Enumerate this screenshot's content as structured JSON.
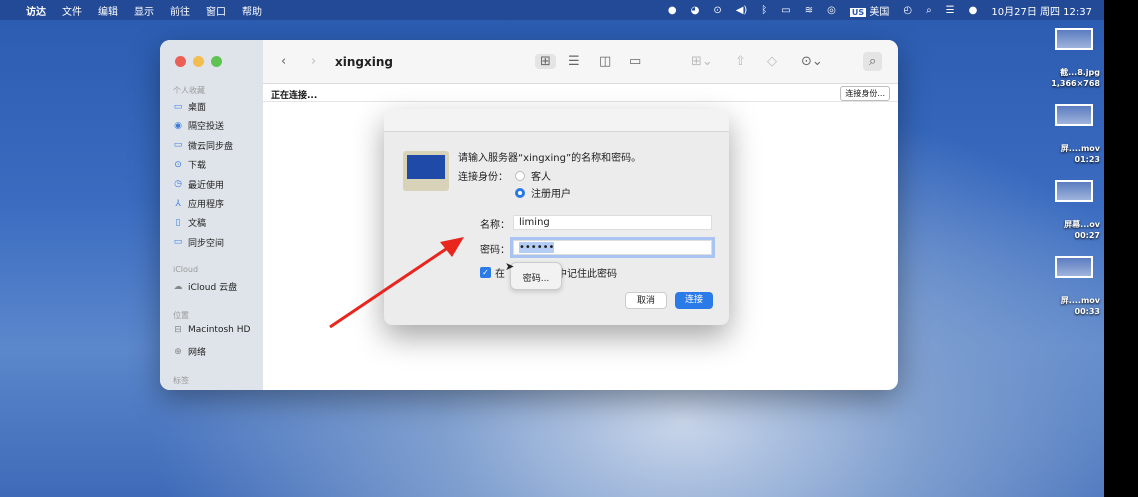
{
  "menubar": {
    "apple": "",
    "items": [
      "访达",
      "文件",
      "编辑",
      "显示",
      "前往",
      "窗口",
      "帮助"
    ],
    "input_source": "美国",
    "datetime": "10月27日 周四 12:37"
  },
  "finder": {
    "title": "xingxing",
    "status": "正在连接...",
    "connect_as": "连接身份...",
    "sidebar": {
      "favorites": "个人收藏",
      "items": [
        {
          "icon": "desktop-icon",
          "g": "▭",
          "label": "桌面"
        },
        {
          "icon": "airdrop-icon",
          "g": "◉",
          "label": "隔空投送"
        },
        {
          "icon": "folder-icon",
          "g": "▭",
          "label": "微云同步盘"
        },
        {
          "icon": "download-icon",
          "g": "⊙",
          "label": "下载"
        },
        {
          "icon": "recent-icon",
          "g": "◷",
          "label": "最近使用"
        },
        {
          "icon": "apps-icon",
          "g": "⅄",
          "label": "应用程序"
        },
        {
          "icon": "document-icon",
          "g": "▯",
          "label": "文稿"
        },
        {
          "icon": "folder-icon",
          "g": "▭",
          "label": "同步空间"
        }
      ],
      "icloud": "iCloud",
      "icloud_drive": "iCloud 云盘",
      "locations": "位置",
      "mac_hd": "Macintosh HD",
      "network": "网络",
      "tags": "标签"
    }
  },
  "dialog": {
    "prompt": "请输入服务器“xingxing”的名称和密码。",
    "connect_as_label": "连接身份：",
    "guest": "客人",
    "registered": "注册用户",
    "name_label": "名称：",
    "name_value": "liming",
    "password_label": "密码：",
    "password_value": "••••••",
    "remember_prefix": "在",
    "remember_suffix": "中记住此密码",
    "tooltip": "密码...",
    "cancel": "取消",
    "connect": "连接"
  },
  "desktop": [
    {
      "name": "截...8.jpg",
      "meta": "1,366×768"
    },
    {
      "name": "屏....mov",
      "meta": "01:23"
    },
    {
      "name": "屏幕...ov",
      "meta": "00:27"
    },
    {
      "name": "屏....mov",
      "meta": "00:33"
    }
  ]
}
